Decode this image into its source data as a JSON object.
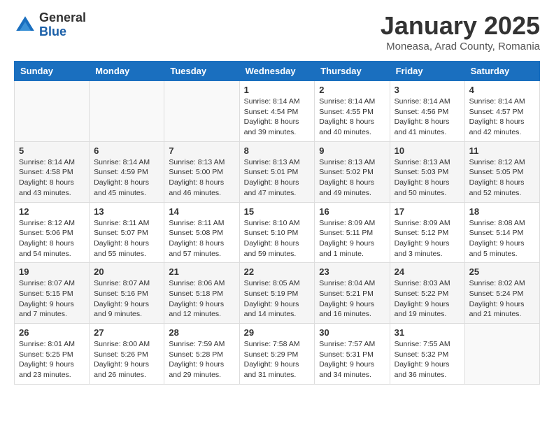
{
  "header": {
    "logo_general": "General",
    "logo_blue": "Blue",
    "title": "January 2025",
    "subtitle": "Moneasa, Arad County, Romania"
  },
  "calendar": {
    "days_of_week": [
      "Sunday",
      "Monday",
      "Tuesday",
      "Wednesday",
      "Thursday",
      "Friday",
      "Saturday"
    ],
    "weeks": [
      [
        {
          "day": "",
          "info": ""
        },
        {
          "day": "",
          "info": ""
        },
        {
          "day": "",
          "info": ""
        },
        {
          "day": "1",
          "info": "Sunrise: 8:14 AM\nSunset: 4:54 PM\nDaylight: 8 hours\nand 39 minutes."
        },
        {
          "day": "2",
          "info": "Sunrise: 8:14 AM\nSunset: 4:55 PM\nDaylight: 8 hours\nand 40 minutes."
        },
        {
          "day": "3",
          "info": "Sunrise: 8:14 AM\nSunset: 4:56 PM\nDaylight: 8 hours\nand 41 minutes."
        },
        {
          "day": "4",
          "info": "Sunrise: 8:14 AM\nSunset: 4:57 PM\nDaylight: 8 hours\nand 42 minutes."
        }
      ],
      [
        {
          "day": "5",
          "info": "Sunrise: 8:14 AM\nSunset: 4:58 PM\nDaylight: 8 hours\nand 43 minutes."
        },
        {
          "day": "6",
          "info": "Sunrise: 8:14 AM\nSunset: 4:59 PM\nDaylight: 8 hours\nand 45 minutes."
        },
        {
          "day": "7",
          "info": "Sunrise: 8:13 AM\nSunset: 5:00 PM\nDaylight: 8 hours\nand 46 minutes."
        },
        {
          "day": "8",
          "info": "Sunrise: 8:13 AM\nSunset: 5:01 PM\nDaylight: 8 hours\nand 47 minutes."
        },
        {
          "day": "9",
          "info": "Sunrise: 8:13 AM\nSunset: 5:02 PM\nDaylight: 8 hours\nand 49 minutes."
        },
        {
          "day": "10",
          "info": "Sunrise: 8:13 AM\nSunset: 5:03 PM\nDaylight: 8 hours\nand 50 minutes."
        },
        {
          "day": "11",
          "info": "Sunrise: 8:12 AM\nSunset: 5:05 PM\nDaylight: 8 hours\nand 52 minutes."
        }
      ],
      [
        {
          "day": "12",
          "info": "Sunrise: 8:12 AM\nSunset: 5:06 PM\nDaylight: 8 hours\nand 54 minutes."
        },
        {
          "day": "13",
          "info": "Sunrise: 8:11 AM\nSunset: 5:07 PM\nDaylight: 8 hours\nand 55 minutes."
        },
        {
          "day": "14",
          "info": "Sunrise: 8:11 AM\nSunset: 5:08 PM\nDaylight: 8 hours\nand 57 minutes."
        },
        {
          "day": "15",
          "info": "Sunrise: 8:10 AM\nSunset: 5:10 PM\nDaylight: 8 hours\nand 59 minutes."
        },
        {
          "day": "16",
          "info": "Sunrise: 8:09 AM\nSunset: 5:11 PM\nDaylight: 9 hours\nand 1 minute."
        },
        {
          "day": "17",
          "info": "Sunrise: 8:09 AM\nSunset: 5:12 PM\nDaylight: 9 hours\nand 3 minutes."
        },
        {
          "day": "18",
          "info": "Sunrise: 8:08 AM\nSunset: 5:14 PM\nDaylight: 9 hours\nand 5 minutes."
        }
      ],
      [
        {
          "day": "19",
          "info": "Sunrise: 8:07 AM\nSunset: 5:15 PM\nDaylight: 9 hours\nand 7 minutes."
        },
        {
          "day": "20",
          "info": "Sunrise: 8:07 AM\nSunset: 5:16 PM\nDaylight: 9 hours\nand 9 minutes."
        },
        {
          "day": "21",
          "info": "Sunrise: 8:06 AM\nSunset: 5:18 PM\nDaylight: 9 hours\nand 12 minutes."
        },
        {
          "day": "22",
          "info": "Sunrise: 8:05 AM\nSunset: 5:19 PM\nDaylight: 9 hours\nand 14 minutes."
        },
        {
          "day": "23",
          "info": "Sunrise: 8:04 AM\nSunset: 5:21 PM\nDaylight: 9 hours\nand 16 minutes."
        },
        {
          "day": "24",
          "info": "Sunrise: 8:03 AM\nSunset: 5:22 PM\nDaylight: 9 hours\nand 19 minutes."
        },
        {
          "day": "25",
          "info": "Sunrise: 8:02 AM\nSunset: 5:24 PM\nDaylight: 9 hours\nand 21 minutes."
        }
      ],
      [
        {
          "day": "26",
          "info": "Sunrise: 8:01 AM\nSunset: 5:25 PM\nDaylight: 9 hours\nand 23 minutes."
        },
        {
          "day": "27",
          "info": "Sunrise: 8:00 AM\nSunset: 5:26 PM\nDaylight: 9 hours\nand 26 minutes."
        },
        {
          "day": "28",
          "info": "Sunrise: 7:59 AM\nSunset: 5:28 PM\nDaylight: 9 hours\nand 29 minutes."
        },
        {
          "day": "29",
          "info": "Sunrise: 7:58 AM\nSunset: 5:29 PM\nDaylight: 9 hours\nand 31 minutes."
        },
        {
          "day": "30",
          "info": "Sunrise: 7:57 AM\nSunset: 5:31 PM\nDaylight: 9 hours\nand 34 minutes."
        },
        {
          "day": "31",
          "info": "Sunrise: 7:55 AM\nSunset: 5:32 PM\nDaylight: 9 hours\nand 36 minutes."
        },
        {
          "day": "",
          "info": ""
        }
      ]
    ]
  }
}
